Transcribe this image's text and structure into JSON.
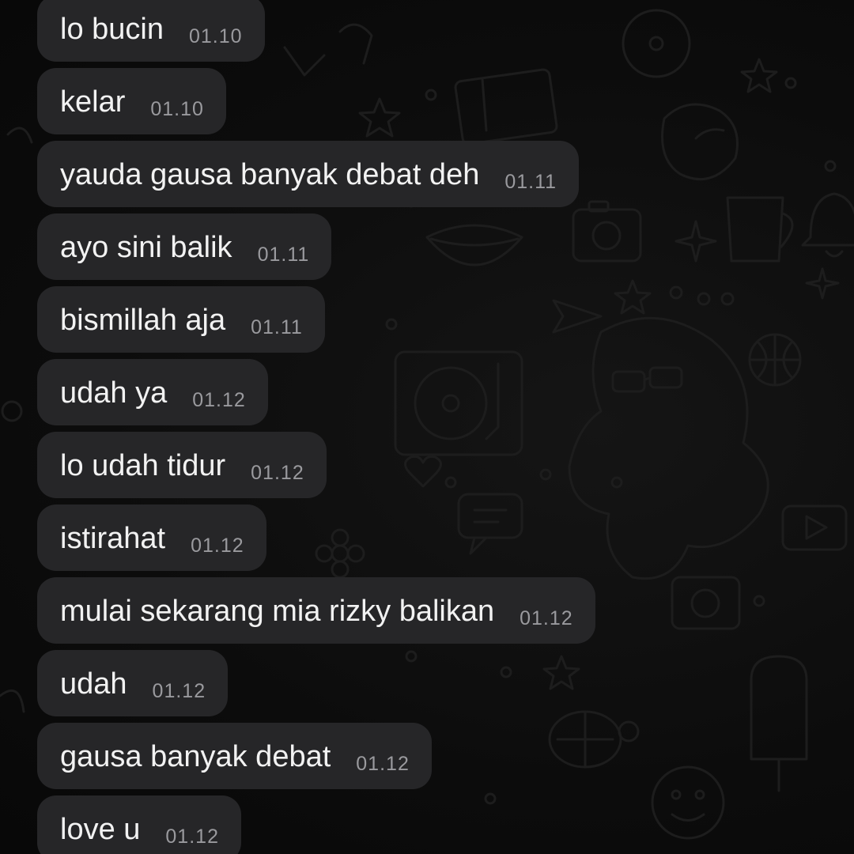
{
  "messages": [
    {
      "text": "lo bucin",
      "time": "01.10"
    },
    {
      "text": "kelar",
      "time": "01.10"
    },
    {
      "text": "yauda gausa banyak debat deh",
      "time": "01.11"
    },
    {
      "text": "ayo sini balik",
      "time": "01.11"
    },
    {
      "text": "bismillah aja",
      "time": "01.11"
    },
    {
      "text": "udah ya",
      "time": "01.12"
    },
    {
      "text": "lo udah tidur",
      "time": "01.12"
    },
    {
      "text": "istirahat",
      "time": "01.12"
    },
    {
      "text": "mulai sekarang mia rizky balikan",
      "time": "01.12"
    },
    {
      "text": "udah",
      "time": "01.12"
    },
    {
      "text": "gausa banyak debat",
      "time": "01.12"
    },
    {
      "text": "love u",
      "time": "01.12"
    }
  ],
  "colors": {
    "background": "#0b0b0b",
    "bubble": "#262628",
    "message_text": "#f2f2f2",
    "timestamp": "#9a9a9e"
  }
}
